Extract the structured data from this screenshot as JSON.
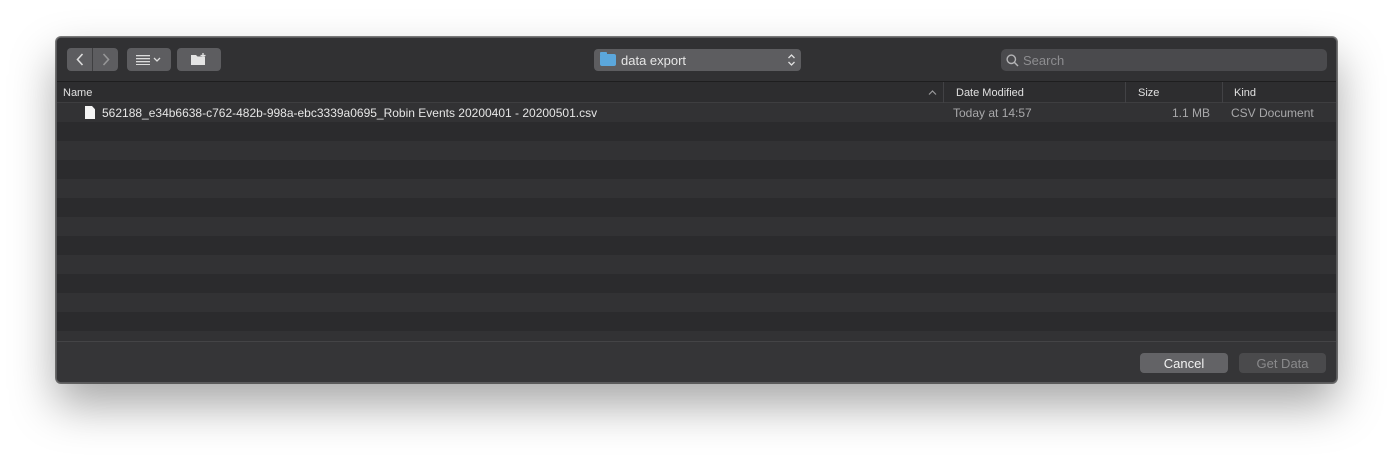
{
  "toolbar": {
    "back_icon": "chevron-left-icon",
    "forward_icon": "chevron-right-icon",
    "view_icon": "list-view-icon",
    "new_folder_icon": "new-folder-icon",
    "location": "data export",
    "search_placeholder": "Search"
  },
  "columns": {
    "name": "Name",
    "date_modified": "Date Modified",
    "size": "Size",
    "kind": "Kind"
  },
  "files": [
    {
      "name": "562188_e34b6638-c762-482b-998a-ebc3339a0695_Robin Events 20200401 - 20200501.csv",
      "date_modified": "Today at 14:57",
      "size": "1.1 MB",
      "kind": "CSV Document"
    }
  ],
  "footer": {
    "cancel_label": "Cancel",
    "primary_label": "Get Data"
  },
  "colors": {
    "dialog_bg": "#2b2b2d",
    "folder_accent": "#5ba7dc"
  }
}
